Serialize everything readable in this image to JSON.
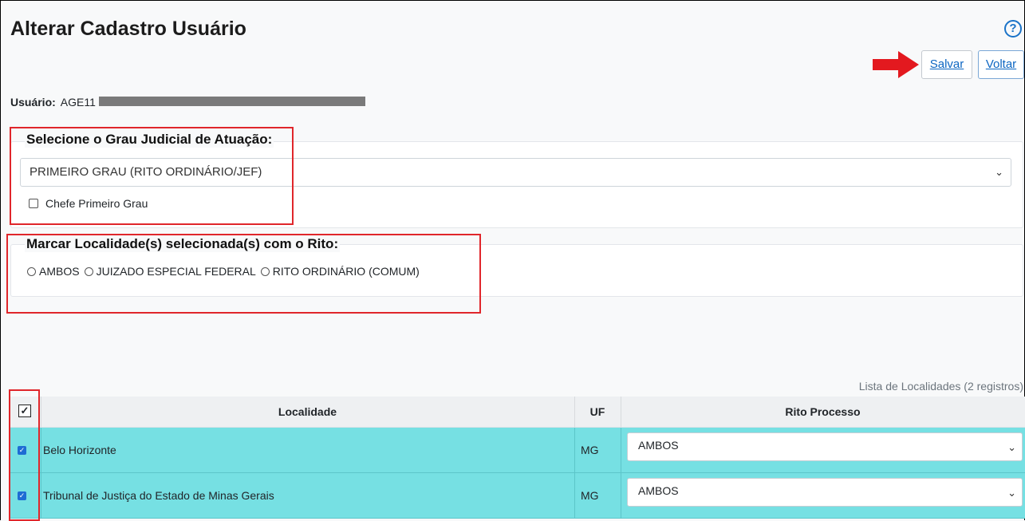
{
  "page": {
    "title": "Alterar Cadastro Usuário",
    "help_icon": "question-circle-icon"
  },
  "toolbar": {
    "save_label": "Salvar",
    "back_label": "Voltar",
    "arrow_icon": "red-arrow-right-icon"
  },
  "user": {
    "label": "Usuário:",
    "value": "AGE11"
  },
  "grau": {
    "legend": "Selecione o Grau Judicial de Atuação:",
    "selected": "PRIMEIRO GRAU (RITO ORDINÁRIO/JEF)",
    "chefe_label": "Chefe Primeiro Grau",
    "chefe_checked": false
  },
  "rito": {
    "legend": "Marcar Localidade(s) selecionada(s) com o Rito:",
    "options": [
      "AMBOS",
      "JUIZADO ESPECIAL FEDERAL",
      "RITO ORDINÁRIO (COMUM)"
    ]
  },
  "list": {
    "caption": "Lista de Localidades (2 registros)",
    "headers": {
      "localidade": "Localidade",
      "uf": "UF",
      "rito": "Rito Processo"
    },
    "rows": [
      {
        "localidade": "Belo Horizonte",
        "uf": "MG",
        "rito": "AMBOS",
        "checked": true
      },
      {
        "localidade": "Tribunal de Justiça do Estado de Minas Gerais",
        "uf": "MG",
        "rito": "AMBOS",
        "checked": true
      }
    ]
  },
  "colors": {
    "accent": "#0d66c2",
    "row_highlight": "#76e0e3",
    "annotation": "#e0262b"
  }
}
